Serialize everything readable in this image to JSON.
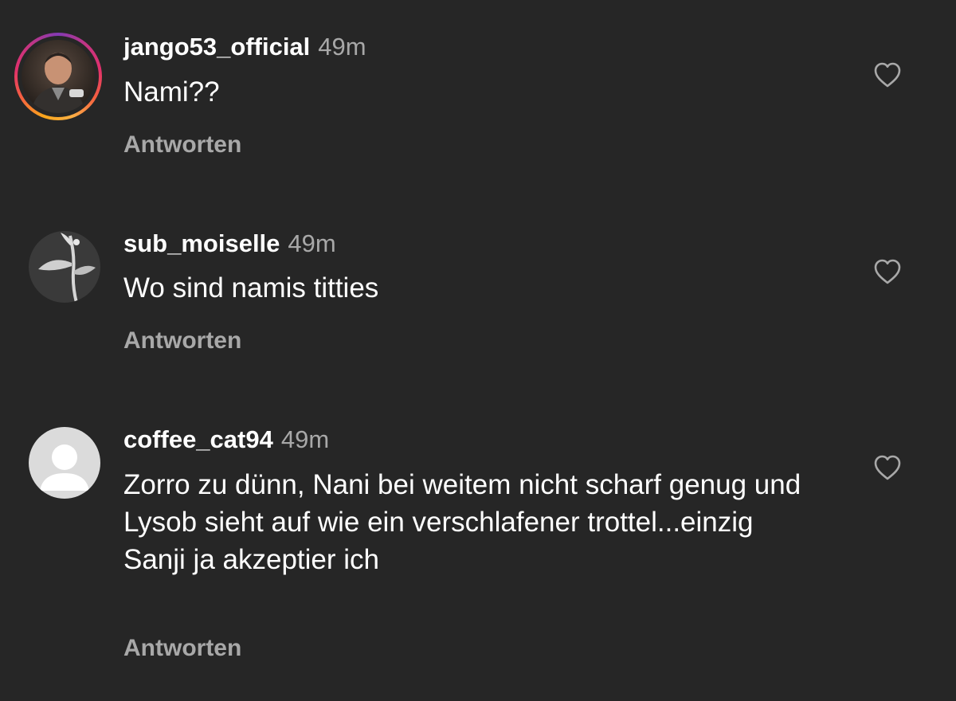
{
  "comments": [
    {
      "username": "jango53_official",
      "time": "49m",
      "text": "Nami??",
      "reply_label": "Antworten",
      "avatar_icon": "user-photo-icon",
      "has_story_ring": true
    },
    {
      "username": "sub_moiselle",
      "time": "49m",
      "text": "Wo sind namis titties",
      "reply_label": "Antworten",
      "avatar_icon": "user-photo-icon",
      "has_story_ring": false
    },
    {
      "username": "coffee_cat94",
      "time": "49m",
      "text": "Zorro zu dünn, Nani bei weitem nicht scharf genug und Lysob sieht auf wie ein verschlafener trottel...einzig Sanji ja akzeptier ich",
      "reply_label": "Antworten",
      "avatar_icon": "default-avatar-icon",
      "has_story_ring": false
    }
  ],
  "like_icon": "heart-outline-icon",
  "colors": {
    "background": "#262626",
    "primary_text": "#ffffff",
    "secondary_text": "#a8a8a8"
  }
}
